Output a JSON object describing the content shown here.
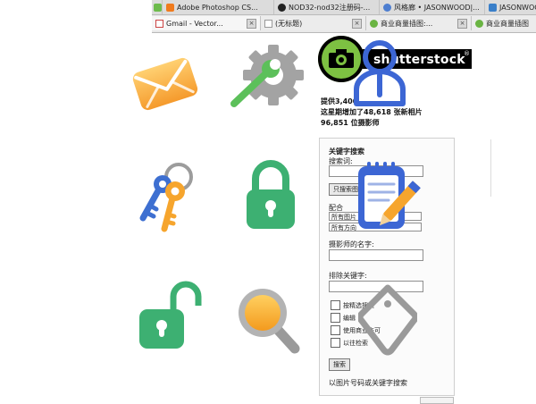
{
  "browser": {
    "row1_tabs": [
      {
        "label": "Adobe Photoshop CS...",
        "icon": "photoshop-icon"
      },
      {
        "label": "NOD32-nod32注册码-...",
        "icon": "nod32-icon"
      },
      {
        "label": "风格廊 • JASONWOOD|...",
        "icon": "gallery-icon"
      },
      {
        "label": "JASONWOO",
        "icon": "cart-icon"
      }
    ],
    "row2_tabs": [
      {
        "label": "Gmail - Vector...",
        "icon": "gmail-icon"
      },
      {
        "label": "(无标题)",
        "icon": "page-icon"
      },
      {
        "label": "商业商量插图:...",
        "icon": "stock-icon"
      },
      {
        "label": "商业商量插图",
        "icon": "stock-icon"
      }
    ]
  },
  "logo": {
    "text": "shutterstock",
    "reg": "®"
  },
  "stats": {
    "line1": "提供3,400,...",
    "line2": "这星期增加了48,618 张新相片",
    "line3": "96,851 位摄影师"
  },
  "search": {
    "title": "关键字搜索",
    "keyword_label": "搜索词:",
    "only_in_button": "只搜索图",
    "match_label": "配合",
    "select_all_images": "所有图片",
    "select_all_orient": "所有方向",
    "photographer_label": "摄影师的名字:",
    "exclude_label": "排除关键字:",
    "checkboxes": [
      "按精选搜索",
      "编辑",
      "使用商业许可",
      "以往检索"
    ],
    "search_button": "搜索",
    "bottom_link": "以图片号码或关键字搜索"
  },
  "colors": {
    "envelope": "#f9a94a",
    "gear": "#9e9e9e",
    "wrench": "#5cc05a",
    "lock_green": "#3db072",
    "key_blue": "#3d6fd1",
    "key_orange": "#f6a52d",
    "magnifier": "#f9b030",
    "user_blue": "#3c66d4",
    "tag_gray": "#9a9a9a"
  },
  "icons": [
    "envelope-icon",
    "settings-icon",
    "keys-icon",
    "lock-icon",
    "unlock-icon",
    "search-icon",
    "user-icon",
    "notepad-icon",
    "tag-icon"
  ]
}
